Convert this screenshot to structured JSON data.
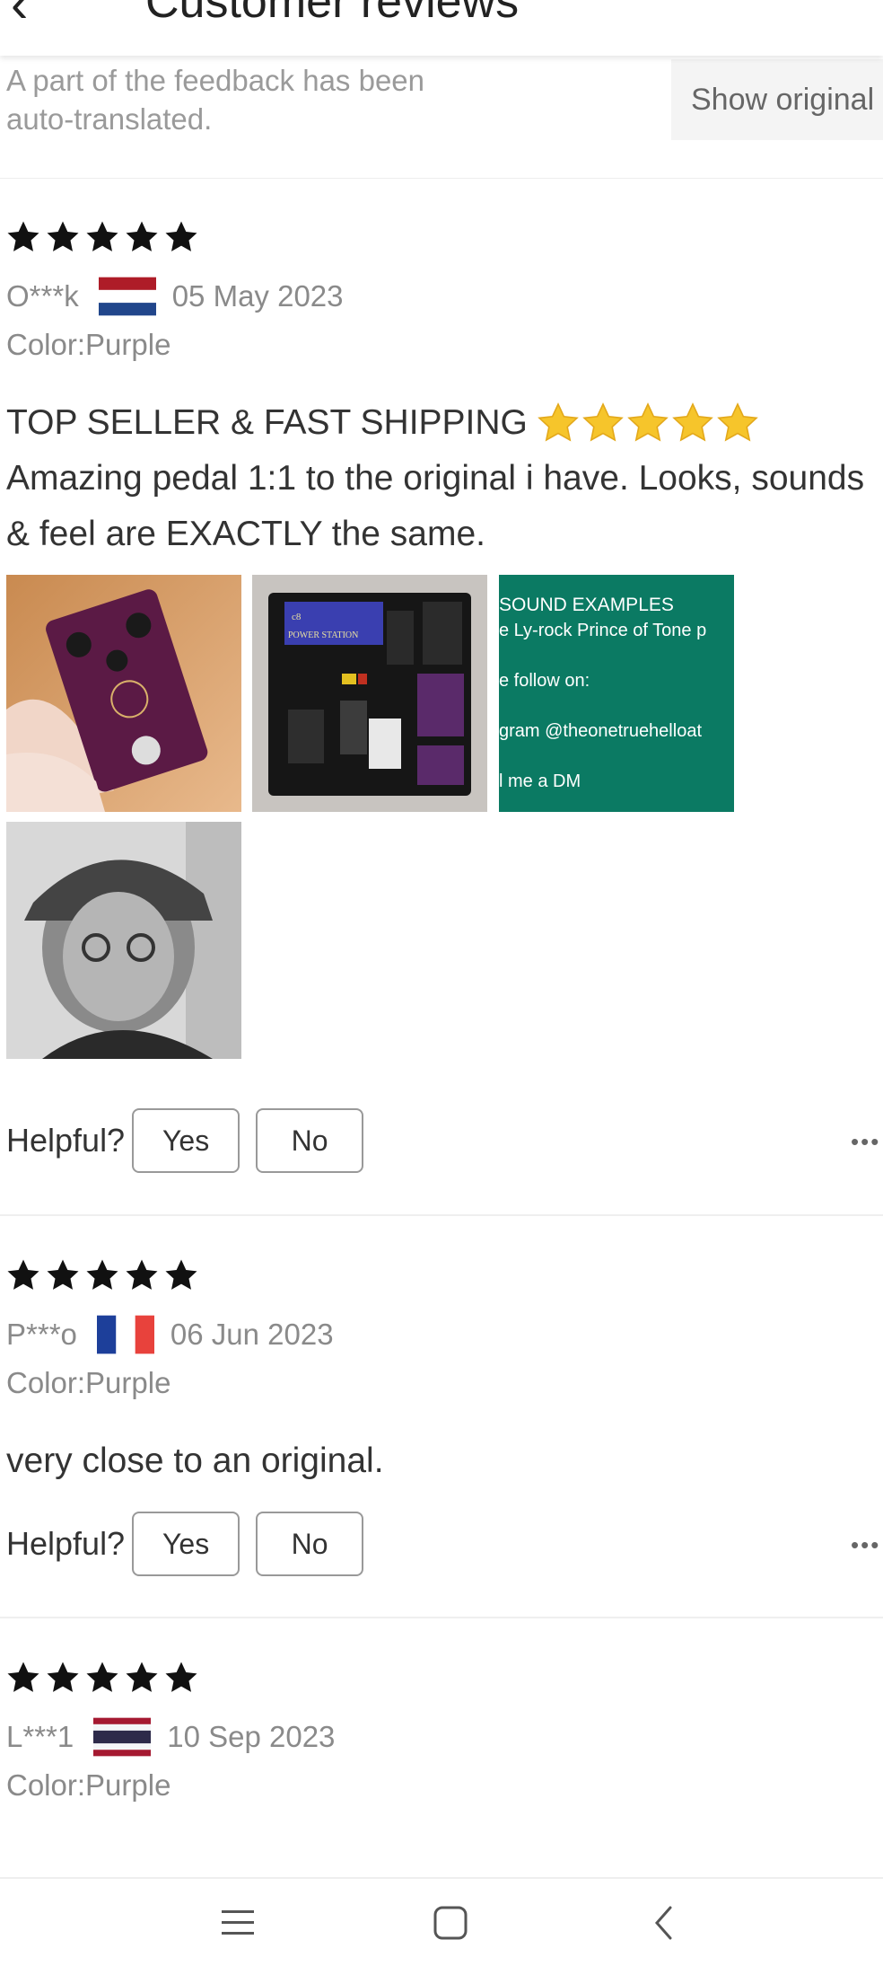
{
  "header": {
    "back_icon": "back-arrow-icon",
    "title": "Customer reviews"
  },
  "translation_notice": {
    "text": "A part of the feedback has been auto-translated.",
    "button_label": "Show original"
  },
  "reviews": [
    {
      "rating": 5,
      "user": "O***k",
      "country_flag": "netherlands-flag-icon",
      "date": "05 May 2023",
      "color": "Color:Purple",
      "title": "TOP SELLER & FAST SHIPPING",
      "title_emoji_stars": 5,
      "text": "Amazing pedal 1:1 to the original i have. Looks, sounds & feel are EXACTLY the same.",
      "photos": [
        {
          "alt": "purple-pedal-in-hand-photo"
        },
        {
          "alt": "pedalboard-photo",
          "caption": "POWER STATION"
        },
        {
          "alt": "sound-examples-screenshot",
          "lines": [
            "SOUND EXAMPLES",
            "e Ly-rock Prince of Tone p",
            "e follow on:",
            "gram @theonetruehelloat",
            "l me a DM"
          ]
        },
        {
          "alt": "reviewer-portrait-photo"
        }
      ],
      "helpful_label": "Helpful?",
      "yes_label": "Yes",
      "no_label": "No",
      "more_label": "•••"
    },
    {
      "rating": 5,
      "user": "P***o",
      "country_flag": "france-flag-icon",
      "date": "06 Jun 2023",
      "color": "Color:Purple",
      "text": "very close to an original.",
      "helpful_label": "Helpful?",
      "yes_label": "Yes",
      "no_label": "No",
      "more_label": "•••"
    },
    {
      "rating": 5,
      "user": "L***1",
      "country_flag": "thailand-flag-icon",
      "date": "10 Sep 2023",
      "color": "Color:Purple"
    }
  ],
  "colors": {
    "star": "#111111",
    "emoji_star": "#f6c52b",
    "muted_text": "#8a8a8a"
  },
  "navbar": {
    "menu_icon": "menu-icon",
    "home_icon": "home-square-icon",
    "back_icon": "back-chevron-icon"
  }
}
